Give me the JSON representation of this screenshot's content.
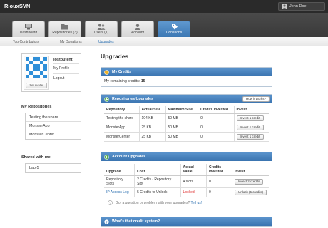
{
  "app": {
    "title": "RiouxSVN",
    "user_button": "John Doe"
  },
  "tabs": [
    {
      "label": "Dashboard",
      "icon": "monitor-icon"
    },
    {
      "label": "Repositories (3)",
      "icon": "folder-icon"
    },
    {
      "label": "Users (1)",
      "icon": "users-icon"
    },
    {
      "label": "Account",
      "icon": "account-icon"
    },
    {
      "label": "Donations",
      "icon": "tag-icon"
    }
  ],
  "subnav": [
    "Top Contributors",
    "My Donations",
    "Upgrades"
  ],
  "profile": {
    "username": "jostoutent",
    "set_avatar": "Set Avatar",
    "links": [
      "My Profile",
      "Logout"
    ]
  },
  "sidebar": {
    "repos_title": "My Repositories",
    "repos": [
      "Testing the share",
      "MonsterApp",
      "MonsterCenter"
    ],
    "shared_title": "Shared with me",
    "shared": [
      "Lab-5"
    ]
  },
  "main": {
    "title": "Upgrades",
    "credits": {
      "header": "My Credits",
      "label": "My remaining credits:",
      "value": "15"
    },
    "repo_upgrades": {
      "header": "Repositories Upgrades",
      "how": "How it works?",
      "columns": [
        "Repository",
        "Actual Size",
        "Maximum Size",
        "Credits Invested",
        "Invest"
      ],
      "rows": [
        {
          "repo": "Testing the share",
          "actual": "104 KB",
          "max": "50 MB",
          "credits": "0",
          "button": "Invest 1 credit"
        },
        {
          "repo": "MonsterApp",
          "actual": "25 KB",
          "max": "50 MB",
          "credits": "0",
          "button": "Invest 1 credit"
        },
        {
          "repo": "MonsterCenter",
          "actual": "25 KB",
          "max": "50 MB",
          "credits": "0",
          "button": "Invest 1 credit"
        }
      ]
    },
    "account_upgrades": {
      "header": "Account Upgrades",
      "columns": [
        "Upgrade",
        "Cost",
        "Actual Value",
        "Credits Invested",
        "Invest"
      ],
      "rows": [
        {
          "upgrade": "Repository Slots",
          "cost": "2 Credits / Repository Slot",
          "value": "4 slots",
          "credits": "0",
          "button": "Invest 2 credits"
        },
        {
          "upgrade": "IP Access Log",
          "cost": "5 Credits to Unlock",
          "value": "Locked",
          "credits": "0",
          "button": "Unlock (5 credits)"
        }
      ],
      "question": "Got a question or problem with your upgrades?",
      "question_link": "Tell us!"
    },
    "info": {
      "header": "What's that credit system?"
    }
  },
  "colors": {
    "accent": "#3c78b4",
    "topbar": "#2a2a2a",
    "locked": "#dd2222"
  }
}
